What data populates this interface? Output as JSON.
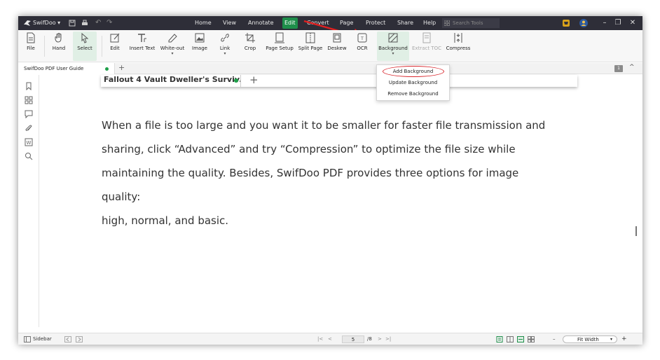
{
  "titlebar": {
    "app_name": "SwifDoo",
    "menus": [
      "Home",
      "View",
      "Annotate",
      "Edit",
      "Convert",
      "Page",
      "Protect",
      "Share",
      "Help"
    ],
    "active_menu": "Edit",
    "search_placeholder": "Search Tools",
    "accent": "#1e8e4a"
  },
  "ribbon": {
    "tools": [
      {
        "label": "File",
        "icon": "file-icon"
      },
      {
        "label": "Hand",
        "icon": "hand-icon"
      },
      {
        "label": "Select",
        "icon": "cursor-icon"
      },
      {
        "label": "Edit",
        "icon": "edit-icon"
      },
      {
        "label": "Insert Text",
        "icon": "insert-text-icon"
      },
      {
        "label": "White-out",
        "icon": "eraser-icon"
      },
      {
        "label": "Image",
        "icon": "image-icon"
      },
      {
        "label": "Link",
        "icon": "link-icon"
      },
      {
        "label": "Crop",
        "icon": "crop-icon"
      },
      {
        "label": "Page Setup",
        "icon": "page-setup-icon"
      },
      {
        "label": "Split Page",
        "icon": "split-page-icon"
      },
      {
        "label": "Deskew",
        "icon": "deskew-icon"
      },
      {
        "label": "OCR",
        "icon": "ocr-icon"
      },
      {
        "label": "Background",
        "icon": "background-icon"
      },
      {
        "label": "Extract TOC",
        "icon": "extract-toc-icon"
      },
      {
        "label": "Compress",
        "icon": "compress-icon"
      }
    ]
  },
  "tabs": {
    "document_tab": "SwifDoo PDF User Guide",
    "page_badge": "1"
  },
  "background_menu": {
    "items": [
      "Add Background",
      "Update Background",
      "Remove Background"
    ],
    "highlight_color": "#d8262c"
  },
  "document": {
    "inner_tab_title": "Fallout 4 Vault Dweller's Surviv...",
    "inner_tab_plus": "+",
    "paragraph": [
      "When a file is too large and you want it to be smaller for faster file transmission and",
      "sharing, click “Advanced” and try “Compression” to optimize the file size while",
      "maintaining the quality. Besides, SwifDoo PDF provides three options for image quality:",
      "high, normal, and basic."
    ]
  },
  "statusbar": {
    "sidebar_label": "Sidebar",
    "current_page": "5",
    "total_pages": "/8",
    "zoom_label": "Fit Width",
    "zoom_minus": "–",
    "zoom_plus": "+"
  }
}
